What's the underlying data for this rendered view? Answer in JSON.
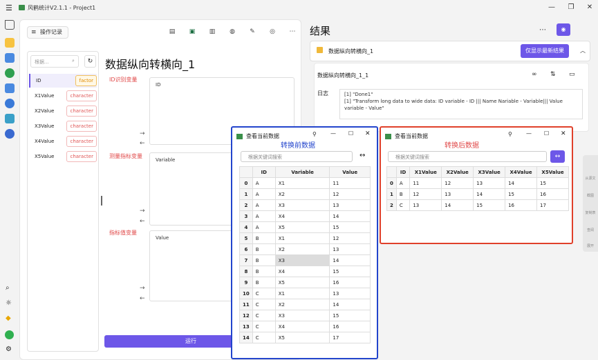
{
  "app_title": "风鹤统计V2.1.1 - Project1",
  "window_controls": {
    "minimize": "—",
    "maximize": "❐",
    "close": "✕"
  },
  "main": {
    "op_log_label": "操作记录",
    "search_placeholder": "根据...",
    "variables": [
      {
        "name": "ID",
        "type": "factor"
      },
      {
        "name": "X1Value",
        "type": "character"
      },
      {
        "name": "X2Value",
        "type": "character"
      },
      {
        "name": "X3Value",
        "type": "character"
      },
      {
        "name": "X4Value",
        "type": "character"
      },
      {
        "name": "X5Value",
        "type": "character"
      }
    ],
    "heading": "数据纵向转横向_1",
    "zones": [
      {
        "annotation": "ID识别变量",
        "label": "ID"
      },
      {
        "annotation": "测量指标变量",
        "label": "Variable"
      },
      {
        "annotation": "指标值变量",
        "label": "Value"
      }
    ],
    "run_label": "运行"
  },
  "result": {
    "title": "结果",
    "item_title": "数据纵向转横向_1",
    "latest_button": "仅显示最新结果",
    "sub_title": "数据纵向转横向_1_1",
    "log_label": "日志",
    "log_lines": [
      "[1] \"Done1\"",
      "[1] \"Transform long data to wide data: ID variable - ID ||| Name Nariable - Variable||| Value variable - Value\""
    ]
  },
  "side_tools": [
    "从源文",
    "截图",
    "复制表",
    "查阅",
    "展开"
  ],
  "dialog_before": {
    "title": "查看当前数据",
    "annotation": "转换前数据",
    "search_placeholder": "根据关键词搜索",
    "columns": [
      "",
      "ID",
      "Variable",
      "Value"
    ],
    "rows": [
      [
        "0",
        "A",
        "X1",
        "11"
      ],
      [
        "1",
        "A",
        "X2",
        "12"
      ],
      [
        "2",
        "A",
        "X3",
        "13"
      ],
      [
        "3",
        "A",
        "X4",
        "14"
      ],
      [
        "4",
        "A",
        "X5",
        "15"
      ],
      [
        "5",
        "B",
        "X1",
        "12"
      ],
      [
        "6",
        "B",
        "X2",
        "13"
      ],
      [
        "7",
        "B",
        "X3",
        "14"
      ],
      [
        "8",
        "B",
        "X4",
        "15"
      ],
      [
        "9",
        "B",
        "X5",
        "16"
      ],
      [
        "10",
        "C",
        "X1",
        "13"
      ],
      [
        "11",
        "C",
        "X2",
        "14"
      ],
      [
        "12",
        "C",
        "X3",
        "15"
      ],
      [
        "13",
        "C",
        "X4",
        "16"
      ],
      [
        "14",
        "C",
        "X5",
        "17"
      ]
    ],
    "highlight_cell": "7-2"
  },
  "dialog_after": {
    "title": "查看当前数据",
    "annotation": "转换后数据",
    "search_placeholder": "根据关键词搜索",
    "columns": [
      "",
      "ID",
      "X1Value",
      "X2Value",
      "X3Value",
      "X4Value",
      "X5Value"
    ],
    "rows": [
      [
        "0",
        "A",
        "11",
        "12",
        "13",
        "14",
        "15"
      ],
      [
        "1",
        "B",
        "12",
        "13",
        "14",
        "15",
        "16"
      ],
      [
        "2",
        "C",
        "13",
        "14",
        "15",
        "16",
        "17"
      ]
    ]
  },
  "colors": {
    "accent": "#6d57e8",
    "blue_border": "#2244cc",
    "red_border": "#e0402a",
    "annotation_red": "#e04848",
    "annotation_blue": "#2244cc"
  }
}
